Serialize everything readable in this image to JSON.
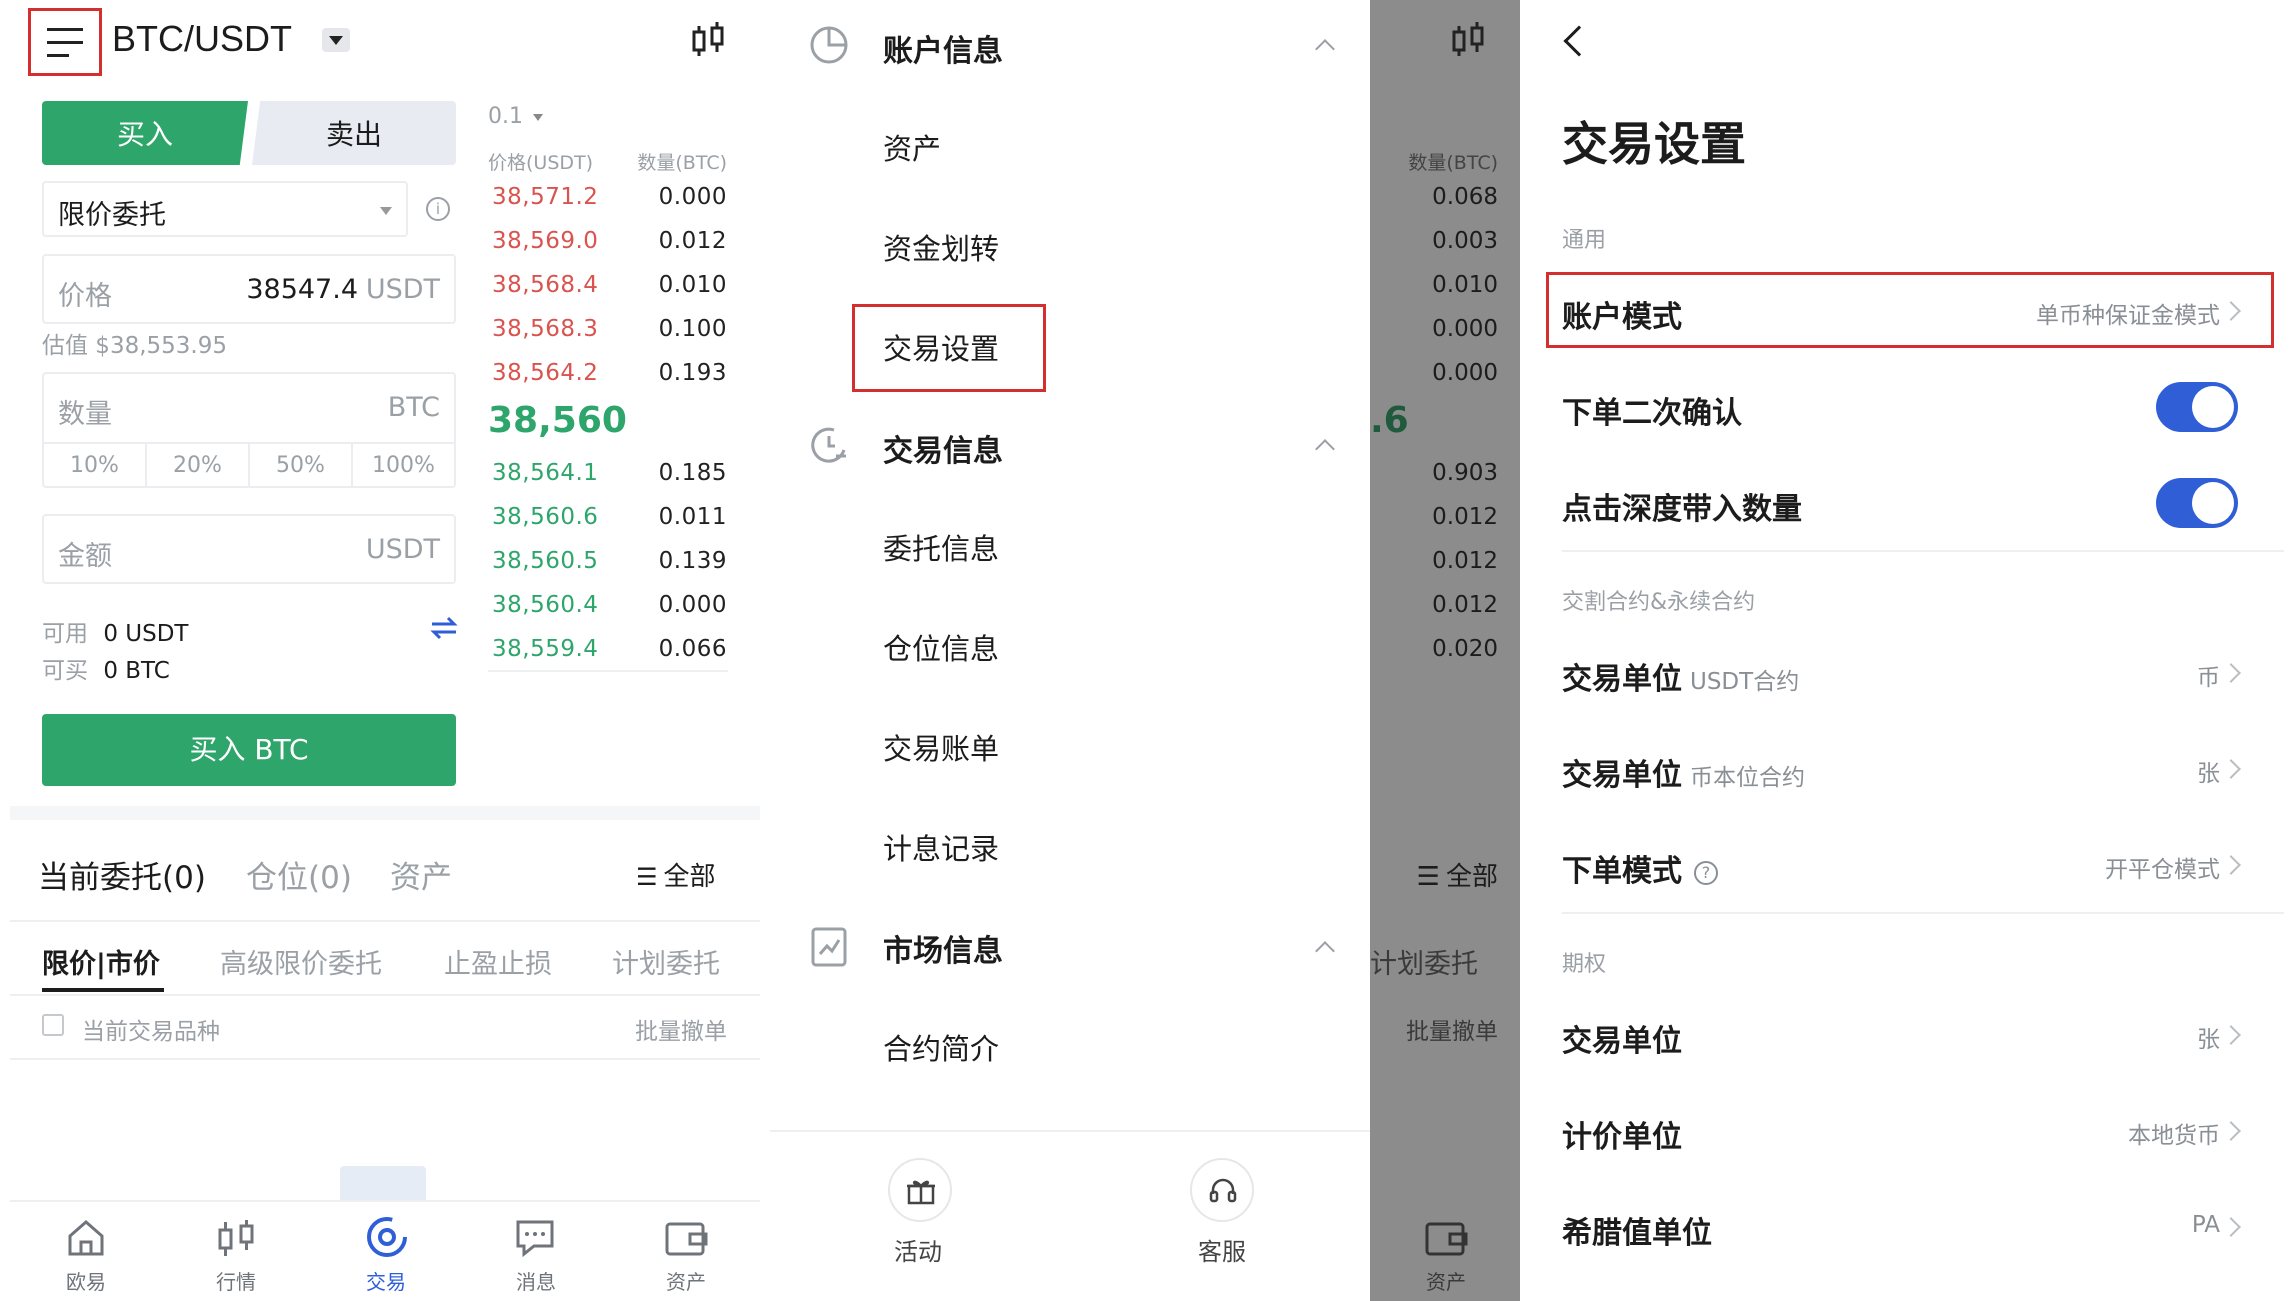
{
  "trade": {
    "pair": "BTC/USDT",
    "buy_tab": "买入",
    "sell_tab": "卖出",
    "order_type": "限价委托",
    "price_label": "价格",
    "price_value": "38547.4",
    "price_unit": "USDT",
    "estimate": "估值 $38,553.95",
    "qty_label": "数量",
    "qty_unit": "BTC",
    "pcts": [
      "10%",
      "20%",
      "50%",
      "100%"
    ],
    "amount_label": "金额",
    "amount_unit": "USDT",
    "avail_label": "可用",
    "avail_value": "0 USDT",
    "canbuy_label": "可买",
    "canbuy_value": "0 BTC",
    "buy_button": "买入 BTC",
    "depth": "0.1",
    "ob_price_header": "价格(USDT)",
    "ob_qty_header": "数量(BTC)",
    "asks": [
      {
        "p": "38,571.2",
        "q": "0.000"
      },
      {
        "p": "38,569.0",
        "q": "0.012"
      },
      {
        "p": "38,568.4",
        "q": "0.010"
      },
      {
        "p": "38,568.3",
        "q": "0.100"
      },
      {
        "p": "38,564.2",
        "q": "0.193"
      }
    ],
    "last_price": "38,560",
    "bids": [
      {
        "p": "38,564.1",
        "q": "0.185"
      },
      {
        "p": "38,560.6",
        "q": "0.011"
      },
      {
        "p": "38,560.5",
        "q": "0.139"
      },
      {
        "p": "38,560.4",
        "q": "0.000"
      },
      {
        "p": "38,559.4",
        "q": "0.066"
      }
    ],
    "orders_tabs": [
      "当前委托(0)",
      "仓位(0)",
      "资产"
    ],
    "all_label": "全部",
    "sub_tabs": [
      "限价|市价",
      "高级限价委托",
      "止盈止损",
      "计划委托"
    ],
    "current_pair_only": "当前交易品种",
    "batch_cancel": "批量撤单",
    "nav": [
      "欧易",
      "行情",
      "交易",
      "消息",
      "资产"
    ]
  },
  "menu": {
    "section1": "账户信息",
    "items1": [
      "资产",
      "资金划转",
      "交易设置"
    ],
    "section2": "交易信息",
    "items2": [
      "委托信息",
      "仓位信息",
      "交易账单",
      "计息记录"
    ],
    "section3": "市场信息",
    "items3": [
      "合约简介"
    ],
    "footer": [
      "活动",
      "客服"
    ]
  },
  "overlay": {
    "qty_header": "数量(BTC)",
    "asks": [
      "0.068",
      "0.003",
      "0.010",
      "0.000",
      "0.000"
    ],
    "last_fragment": ".6",
    "bids": [
      "0.903",
      "0.012",
      "0.012",
      "0.012",
      "0.020"
    ],
    "all_label": "全部",
    "plan": "计划委托",
    "batch": "批量撤单",
    "nav": "资产"
  },
  "settings": {
    "title": "交易设置",
    "general": "通用",
    "account_mode": "账户模式",
    "account_mode_value": "单币种保证金模式",
    "confirm": "下单二次确认",
    "depth_fill": "点击深度带入数量",
    "futures": "交割合约&永续合约",
    "unit": "交易单位",
    "usdt_contract": "USDT合约",
    "usdt_unit": "币",
    "coin_contract": "币本位合约",
    "coin_unit": "张",
    "order_mode": "下单模式",
    "order_mode_value": "开平仓模式",
    "options": "期权",
    "opt_unit": "交易单位",
    "opt_unit_value": "张",
    "pricing": "计价单位",
    "pricing_value": "本地货币",
    "greek": "希腊值单位",
    "greek_value": "PA"
  },
  "colors": {
    "accent_green": "#2ea56b",
    "ask_red": "#d9534f",
    "toggle_blue": "#2f5ed7",
    "highlight_red": "#d32f2f"
  }
}
